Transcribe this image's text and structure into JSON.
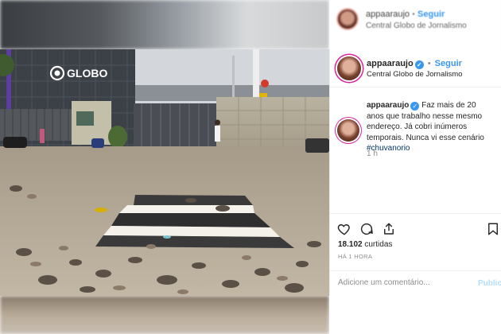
{
  "background": {
    "username": "appaaraujo",
    "follow_label": "Seguir",
    "location": "Central Globo de Jornalismo"
  },
  "post": {
    "photo_alt": "Rua com calçada destruída em frente à sede da Globo",
    "sign_text": "GLOBO",
    "header": {
      "username": "appaaraujo",
      "separator": "•",
      "follow_label": "Seguir",
      "location": "Central Globo de Jornalismo"
    },
    "caption": {
      "username": "appaaraujo",
      "text": "Faz mais de 20 anos que trabalho nesse mesmo endereço. Já cobri inúmeros temporais. Nunca vi esse cenário",
      "hashtag": "#chuvanorio",
      "time_ago": "1 h"
    },
    "likes_count": "18.102",
    "likes_label": "curtidas",
    "posted_ago": "HÁ 1 HORA",
    "comment_placeholder": "Adicione um comentário...",
    "publish_label": "Publica"
  },
  "icons": {
    "like": "heart-icon",
    "comment": "comment-icon",
    "share": "share-icon",
    "save": "bookmark-icon",
    "verified": "verified-badge-icon"
  },
  "colors": {
    "link_blue": "#3897f0",
    "hashtag": "#00376b",
    "muted": "#8e8e8e",
    "story_ring": "#d6249f"
  }
}
